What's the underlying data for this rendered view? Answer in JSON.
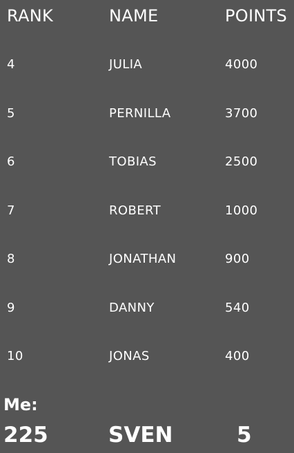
{
  "header": {
    "rank": "RANK",
    "name": "NAME",
    "points": "POINTS"
  },
  "rows": [
    {
      "rank": "4",
      "name": "JULIA",
      "points": "4000"
    },
    {
      "rank": "5",
      "name": "PERNILLA",
      "points": "3700"
    },
    {
      "rank": "6",
      "name": "TOBIAS",
      "points": "2500"
    },
    {
      "rank": "7",
      "name": "ROBERT",
      "points": "1000"
    },
    {
      "rank": "8",
      "name": "JONATHAN",
      "points": "900"
    },
    {
      "rank": "9",
      "name": "DANNY",
      "points": "540"
    },
    {
      "rank": "10",
      "name": "JONAS",
      "points": "400"
    }
  ],
  "me": {
    "label": "Me:",
    "rank": "225",
    "name": "SVEN",
    "points": "5"
  },
  "colors": {
    "background": "#555555",
    "text": "#ffffff"
  }
}
